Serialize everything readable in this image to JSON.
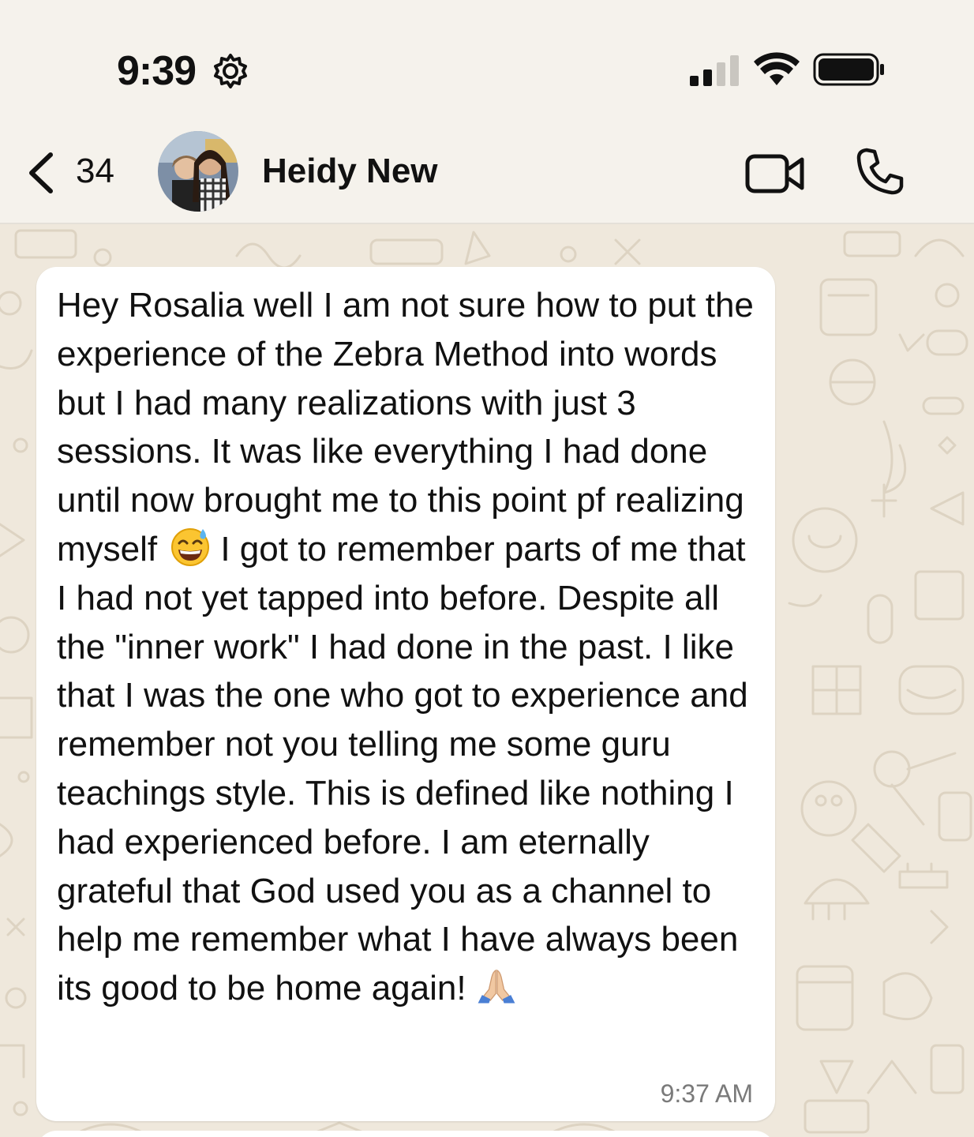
{
  "status_bar": {
    "time": "9:39",
    "icons": [
      "gear-icon",
      "signal-icon",
      "wifi-icon",
      "battery-icon"
    ]
  },
  "header": {
    "back_count": "34",
    "contact_name": "Heidy New",
    "icons": [
      "back-chevron-icon",
      "video-call-icon",
      "phone-call-icon"
    ]
  },
  "message": {
    "text_part1": "Hey Rosalia well I am not sure how to put the experience of the Zebra Method into words but I had many realizations with just 3 sessions. It was like everything I had done until now brought me to this point pf realizing myself",
    "emoji1": "grinning-sweat-emoji",
    "text_part2": " I got to remember parts of me that I had not yet tapped into before. Despite all the \"inner work\" I had done in the past. I like that I was the one who got to experience and remember not you telling me some guru teachings style. This is defined like nothing I had experienced before. I am eternally grateful that God used you as a channel to help me remember what I have always been its good to be home again! ",
    "emoji2": "folded-hands-emoji",
    "timestamp": "9:37 AM"
  },
  "colors": {
    "status_bg": "#f5f2ec",
    "chat_bg": "#efe8dc",
    "bubble_bg": "#ffffff",
    "timestamp": "#7a7a7a"
  }
}
